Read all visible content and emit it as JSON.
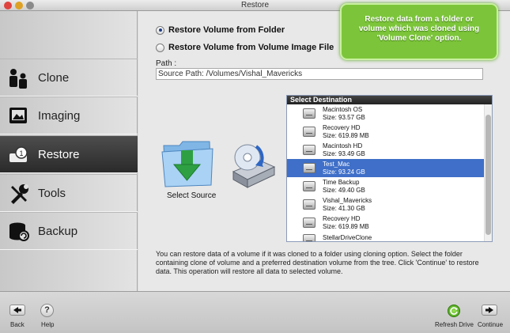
{
  "window": {
    "title": "Restore"
  },
  "sidebar": {
    "items": [
      {
        "label": "Clone",
        "icon": "clone-icon",
        "active": false
      },
      {
        "label": "Imaging",
        "icon": "imaging-icon",
        "active": false
      },
      {
        "label": "Restore",
        "icon": "restore-icon",
        "active": true
      },
      {
        "label": "Tools",
        "icon": "tools-icon",
        "active": false
      },
      {
        "label": "Backup",
        "icon": "backup-icon",
        "active": false
      }
    ]
  },
  "options": {
    "from_folder": "Restore Volume from Folder",
    "from_image": "Restore Volume from Volume Image File",
    "selected": "from_folder"
  },
  "callout": {
    "text": "Restore data from a folder or volume which was cloned using 'Volume Clone' option."
  },
  "path": {
    "label": "Path :",
    "value": "Source Path: /Volumes/Vishal_Mavericks"
  },
  "source": {
    "label": "Select Source"
  },
  "destination": {
    "header": "Select Destination",
    "selected_index": 3,
    "items": [
      {
        "name": "Macintosh OS",
        "size": "Size: 93.57 GB"
      },
      {
        "name": "Recovery HD",
        "size": "Size: 619.89 MB"
      },
      {
        "name": "Macintosh HD",
        "size": "Size: 93.49 GB"
      },
      {
        "name": "Test_Mac",
        "size": "Size: 93.24 GB"
      },
      {
        "name": "Time Backup",
        "size": "Size: 49.40 GB"
      },
      {
        "name": "Vishal_Mavericks",
        "size": "Size: 41.30 GB"
      },
      {
        "name": "Recovery HD",
        "size": "Size: 619.89 MB"
      },
      {
        "name": "StellarDriveClone",
        "size": ""
      }
    ]
  },
  "description": "You can restore data of a volume if it was cloned to a folder using cloning option. Select the folder containing clone of volume and a preferred destination volume from the tree. Click 'Continue' to restore data. This operation will restore all data to selected volume.",
  "toolbar": {
    "back": "Back",
    "help": "Help",
    "help_glyph": "?",
    "refresh": "Refresh Drive",
    "continue": "Continue"
  },
  "colors": {
    "accent": "#3f6fc8",
    "callout": "#7cc53a",
    "active_nav": "#333333"
  }
}
